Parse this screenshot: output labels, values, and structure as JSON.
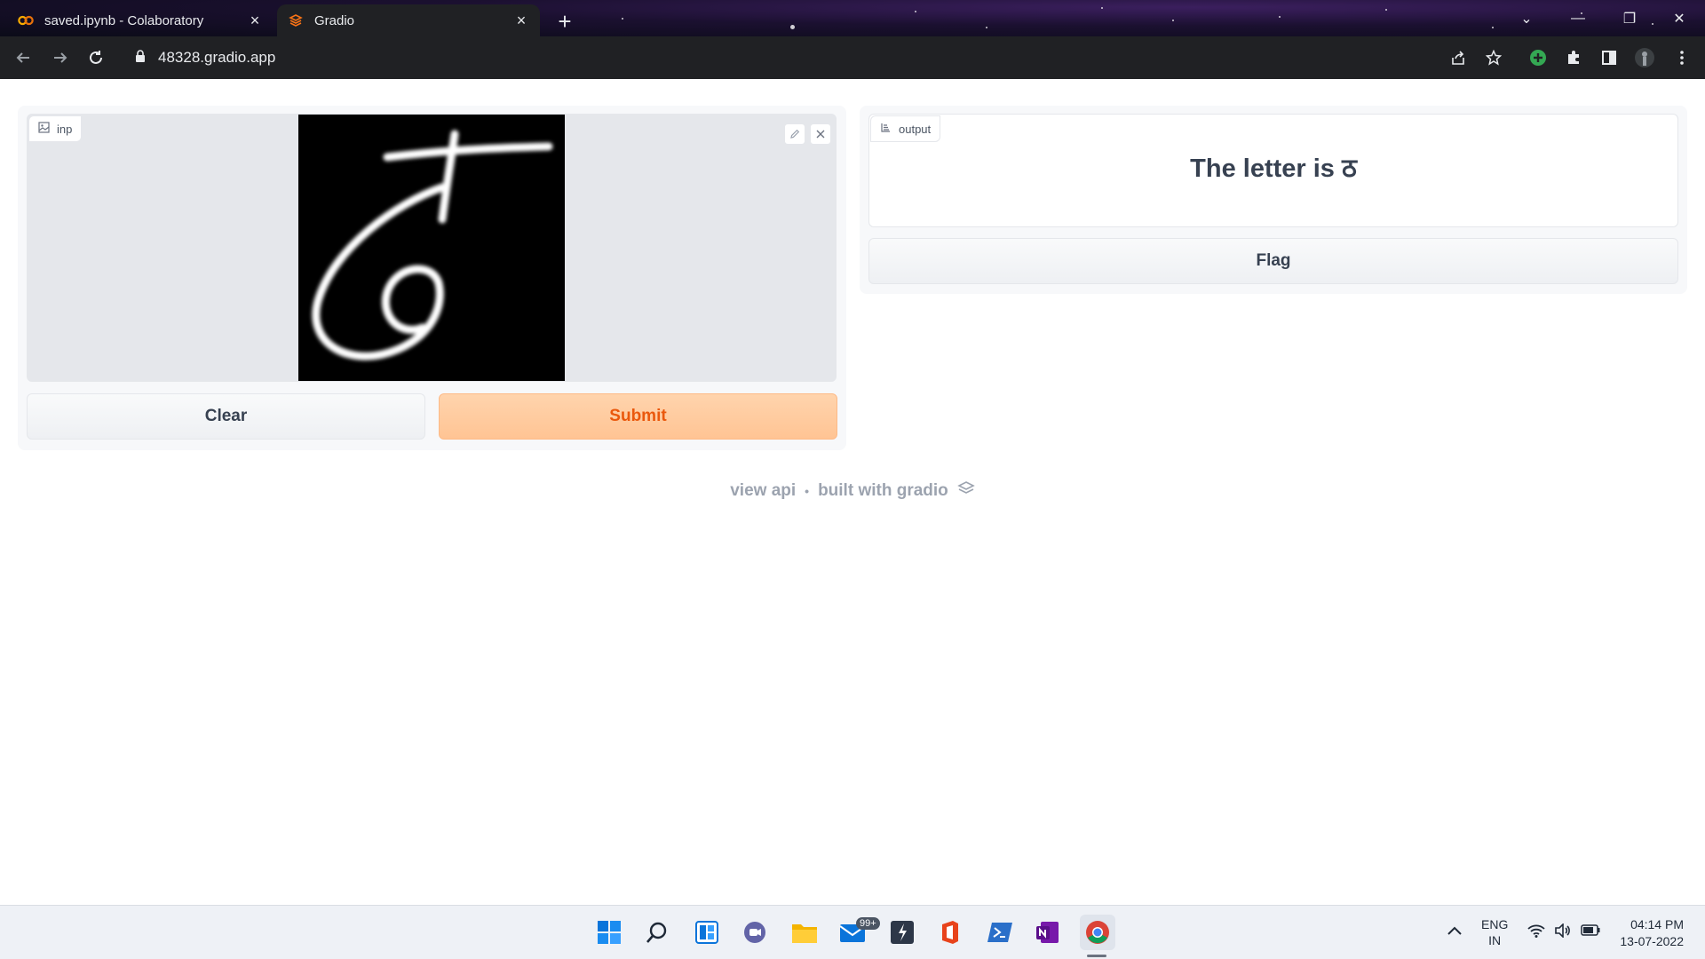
{
  "browser": {
    "tabs": [
      {
        "title": "saved.ipynb - Colaboratory",
        "active": false,
        "icon": "colab-icon"
      },
      {
        "title": "Gradio",
        "active": true,
        "icon": "gradio-icon"
      }
    ],
    "url": "48328.gradio.app"
  },
  "input_panel": {
    "label": "inp",
    "clear_label": "Clear",
    "submit_label": "Submit"
  },
  "output_panel": {
    "label": "output",
    "text": "The letter is ठ",
    "flag_label": "Flag"
  },
  "footer": {
    "view_api": "view api",
    "separator": "•",
    "built_with": "built with gradio"
  },
  "taskbar": {
    "mail_badge": "99+",
    "lang_line1": "ENG",
    "lang_line2": "IN",
    "time": "04:14 PM",
    "date": "13-07-2022"
  },
  "colors": {
    "submit_bg": "#ffd4ad",
    "submit_text": "#ea580c",
    "panel_bg": "#f7f8fa"
  }
}
